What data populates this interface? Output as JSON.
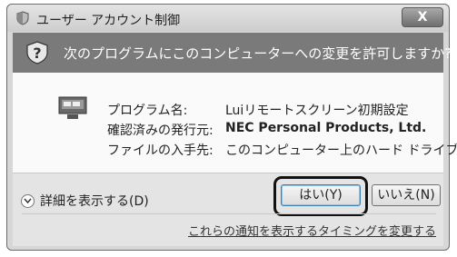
{
  "titlebar": {
    "title": "ユーザー アカウント制御",
    "close_label": "X"
  },
  "banner": {
    "question": "次のプログラムにこのコンピューターへの変更を許可しますか?"
  },
  "details": {
    "program_label": "プログラム名:",
    "program_value": "Luiリモートスクリーン初期設定",
    "publisher_label": "確認済みの発行元:",
    "publisher_value": "NEC Personal Products, Ltd.",
    "source_label": "ファイルの入手先:",
    "source_value": "このコンピューター上のハード ドライブ"
  },
  "footer": {
    "show_details": "詳細を表示する(D)",
    "yes_button": "はい(Y)",
    "no_button": "いいえ(N)",
    "notification_link": "これらの通知を表示するタイミングを変更する"
  },
  "colors": {
    "banner_bg": "#7a7a7a",
    "highlight_border": "#111111",
    "footer_bg": "#e4e4e4"
  }
}
